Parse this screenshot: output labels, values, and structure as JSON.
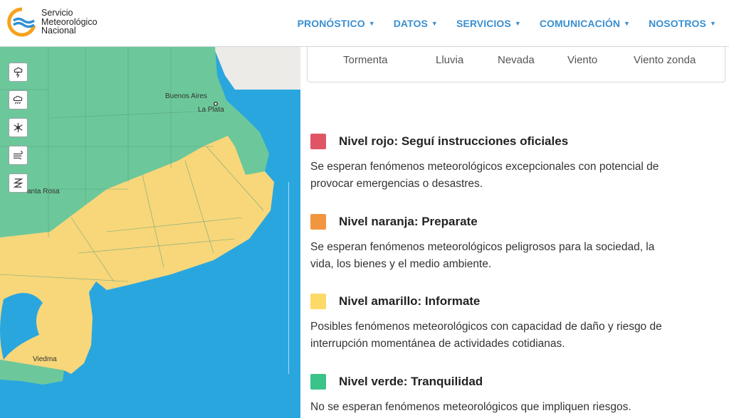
{
  "brand": {
    "line1": "Servicio",
    "line2": "Meteorológico",
    "line3": "Nacional",
    "colors": {
      "orange": "#f6a21e",
      "blue": "#2e8fd4"
    }
  },
  "nav": [
    {
      "label": "PRONÓSTICO",
      "icon": "caret-down-icon"
    },
    {
      "label": "DATOS",
      "icon": "caret-down-icon"
    },
    {
      "label": "SERVICIOS",
      "icon": "caret-down-icon"
    },
    {
      "label": "COMUNICACIÓN",
      "icon": "caret-down-icon"
    },
    {
      "label": "NOSOTROS",
      "icon": "caret-down-icon"
    }
  ],
  "map": {
    "tools": [
      {
        "name": "storm-icon"
      },
      {
        "name": "rain-icon"
      },
      {
        "name": "snow-icon"
      },
      {
        "name": "wind-icon"
      },
      {
        "name": "zonda-wind-icon"
      }
    ],
    "places": {
      "buenos_aires": "Buenos Aires",
      "la_plata": "La Plata",
      "santa_rosa": "anta Rosa",
      "viedma": "Viedma"
    },
    "colors": {
      "sea": "#2aa6df",
      "green": "#6cc89a",
      "yellow": "#f7d77a",
      "land": "#ecebe7"
    }
  },
  "event_types": [
    "Tormenta",
    "Lluvia",
    "Nevada",
    "Viento",
    "Viento zonda"
  ],
  "levels": [
    {
      "color": "#e05566",
      "title": "Nivel rojo: Seguí instrucciones oficiales",
      "desc_1": "Se esperan fenómenos meteorológicos excepcionales con potencial de",
      "desc_2": "provocar emergencias o desastres."
    },
    {
      "color": "#f2953f",
      "title": "Nivel naranja: Preparate",
      "desc_1": "Se esperan fenómenos meteorológicos peligrosos para la sociedad, la",
      "desc_2": "vida, los bienes y el medio ambiente."
    },
    {
      "color": "#fdd968",
      "title": "Nivel amarillo: Informate",
      "desc_1": "Posibles fenómenos meteorológicos con capacidad de daño y riesgo de",
      "desc_2": "interrupción momentánea de actividades cotidianas."
    },
    {
      "color": "#3cc38a",
      "title": "Nivel verde: Tranquilidad",
      "desc_1": "No se esperan fenómenos meteorológicos que impliquen riesgos.",
      "desc_2": ""
    }
  ]
}
